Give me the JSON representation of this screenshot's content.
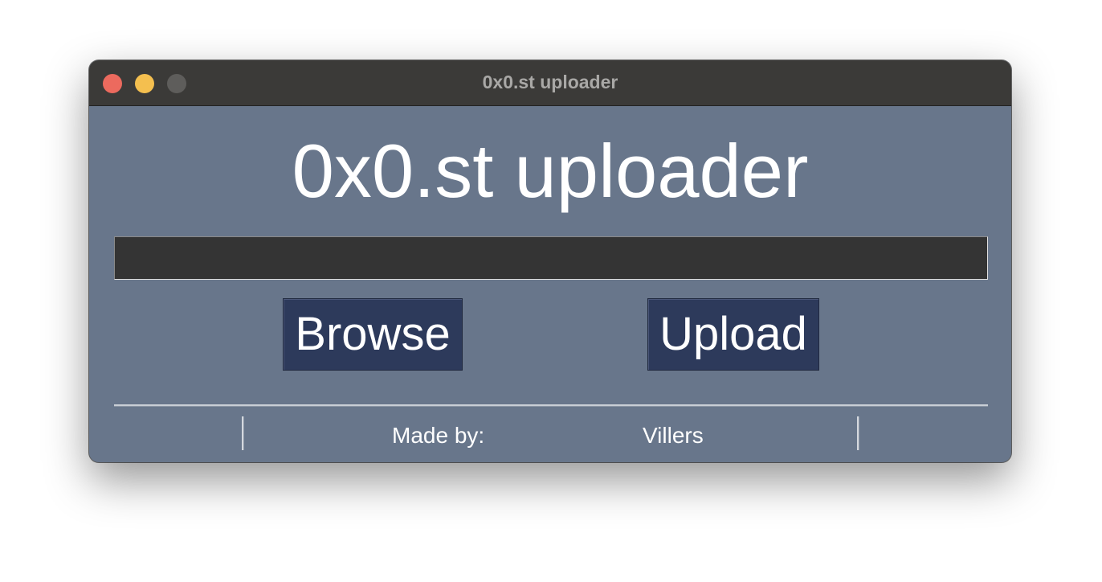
{
  "window": {
    "title": "0x0.st uploader"
  },
  "main": {
    "heading": "0x0.st uploader",
    "file_path_value": "",
    "browse_label": "Browse",
    "upload_label": "Upload"
  },
  "footer": {
    "made_by_label": "Made by:",
    "author": "Villers"
  },
  "colors": {
    "window_background": "#68768b",
    "titlebar": "#3b3a38",
    "entry_background": "#343434",
    "button_background": "#2d3a5b",
    "text": "#ffffff"
  },
  "icons": {
    "close": "close-traffic-light-icon",
    "minimize": "minimize-traffic-light-icon",
    "zoom": "zoom-traffic-light-icon"
  }
}
